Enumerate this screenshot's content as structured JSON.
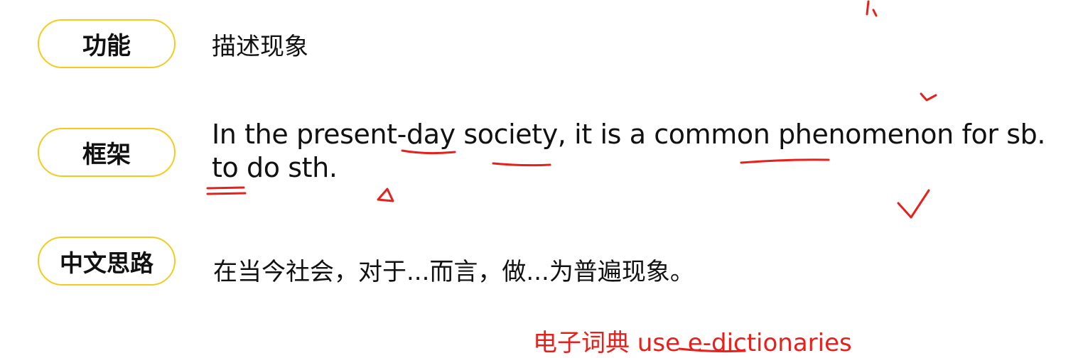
{
  "rows": [
    {
      "label": "功能",
      "content": "描述现象"
    },
    {
      "label": "框架",
      "content": "In the present-day society, it is a common phenomenon for sb. to do sth."
    },
    {
      "label": "中文思路",
      "content": "在当今社会，对于...而言，做...为普遍现象。"
    }
  ],
  "annotation": "电子词典 use e-dictionaries",
  "colors": {
    "pill_border": "#f2cc1d",
    "ink": "#e8201c",
    "text": "#111111"
  },
  "icons": [
    "checkmark-icon",
    "small-check-icon",
    "triangle-mark-icon"
  ]
}
